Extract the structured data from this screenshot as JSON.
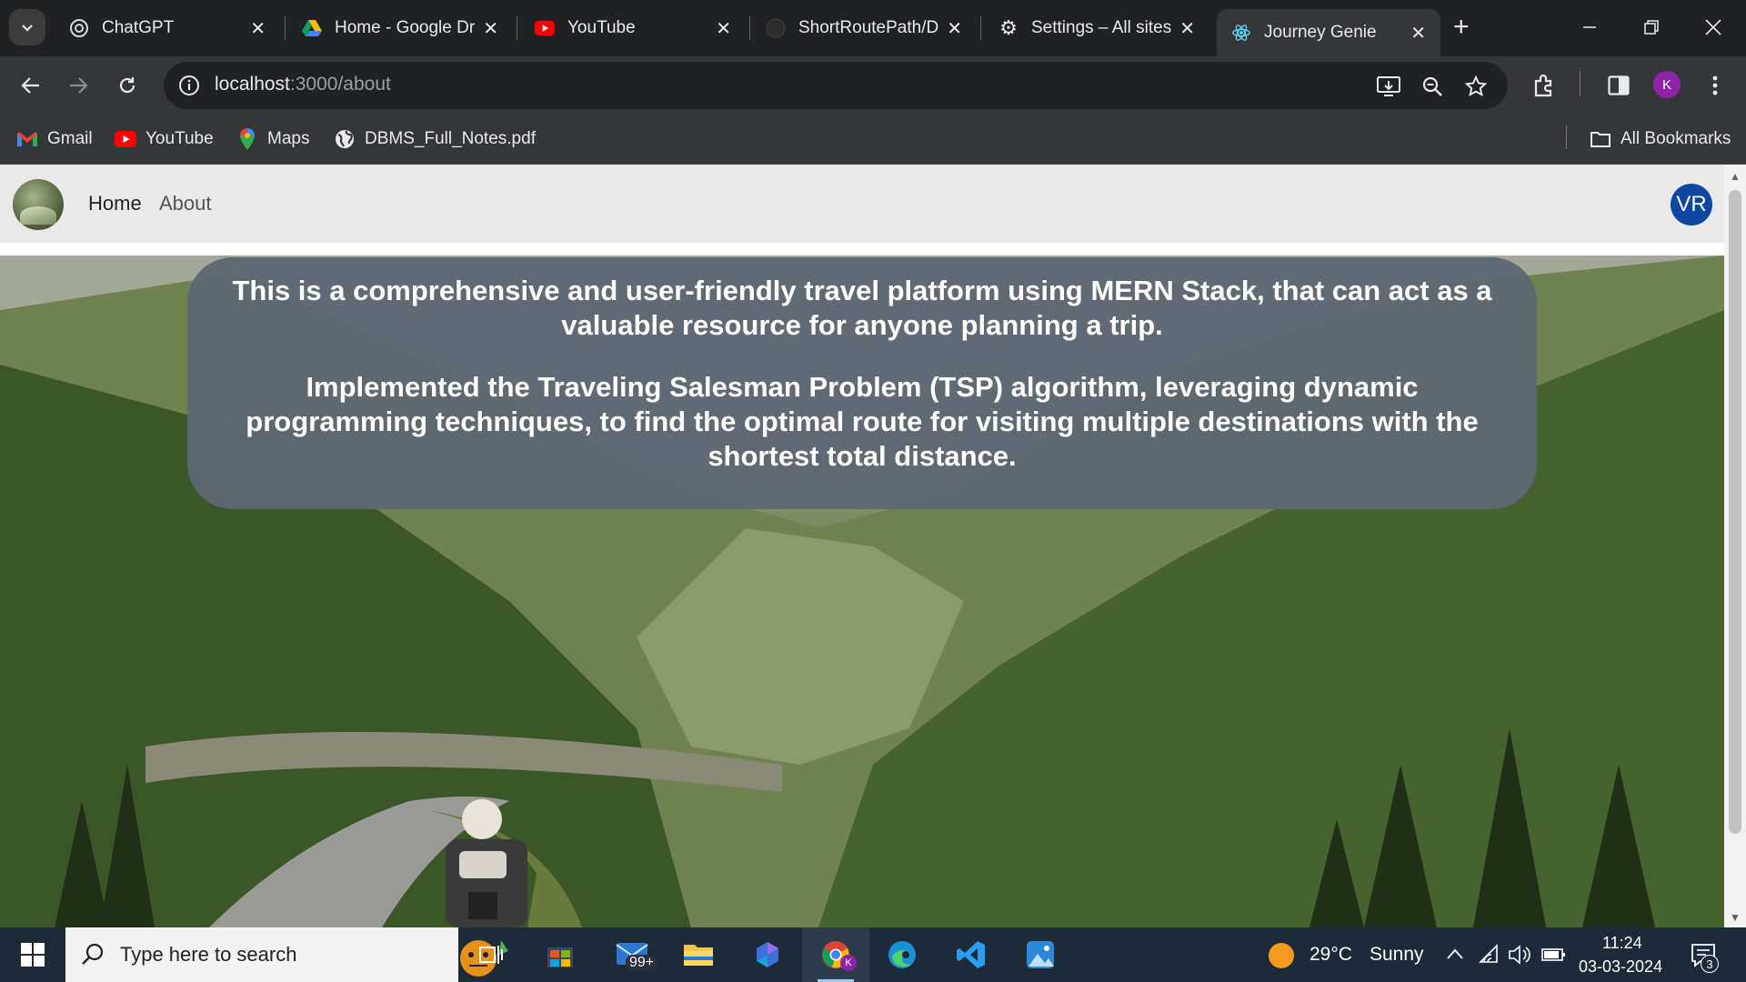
{
  "browser": {
    "tabs": [
      {
        "title": "ChatGPT",
        "icon": "chatgpt-icon"
      },
      {
        "title": "Home - Google Dr",
        "icon": "google-drive-icon"
      },
      {
        "title": "YouTube",
        "icon": "youtube-icon"
      },
      {
        "title": "ShortRoutePath/D",
        "icon": "github-icon"
      },
      {
        "title": "Settings – All sites",
        "icon": "gear-icon"
      },
      {
        "title": "Journey Genie",
        "icon": "react-icon",
        "active": true
      }
    ],
    "address": {
      "host": "localhost",
      "path": ":3000/about"
    },
    "profile_initial": "K",
    "bookmarks": [
      {
        "label": "Gmail",
        "icon": "gmail-icon"
      },
      {
        "label": "YouTube",
        "icon": "youtube-icon"
      },
      {
        "label": "Maps",
        "icon": "maps-icon"
      },
      {
        "label": "DBMS_Full_Notes.pdf",
        "icon": "globe-icon"
      }
    ],
    "all_bookmarks_label": "All Bookmarks"
  },
  "page": {
    "nav": {
      "home": "Home",
      "about": "About",
      "avatar": "VR"
    },
    "about_paragraph_1": "This is a comprehensive and user-friendly travel platform using MERN Stack, that can act as a valuable resource for anyone planning a trip.",
    "about_paragraph_2": "Implemented the Traveling Salesman Problem (TSP) algorithm, leveraging dynamic programming techniques, to find the optimal route for visiting multiple destinations with the shortest total distance.",
    "hero_image": "mountain-valley-motorcycle-road"
  },
  "taskbar": {
    "search_placeholder": "Type here to search",
    "mail_badge": "99+",
    "weather": {
      "temp": "29°C",
      "condition": "Sunny"
    },
    "time": "11:24",
    "date": "03-03-2024",
    "notification_count": "3"
  },
  "colors": {
    "chrome_dark": "#202124",
    "chrome_toolbar": "#35363a",
    "info_box": "#5e6772",
    "avatar": "#0d47a1",
    "profile": "#8e24aa",
    "taskbar": "#1c2a3a"
  }
}
